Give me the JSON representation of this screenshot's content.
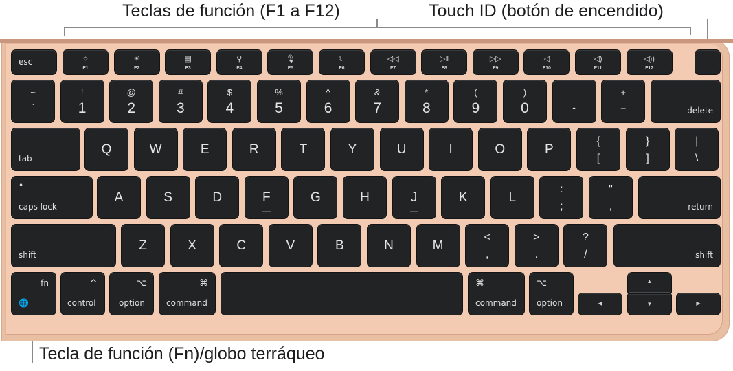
{
  "callouts": {
    "function_keys": "Teclas de función (F1 a F12)",
    "touch_id": "Touch ID (botón de encendido)",
    "fn_globe": "Tecla de función (Fn)/globo terráqueo"
  },
  "colors": {
    "keyboard_body": "#e9bfa4",
    "key": "#222325",
    "key_text": "#e4e4e4",
    "callout_line": "#8a8a8a"
  },
  "function_row": [
    {
      "label": "esc",
      "icon": "",
      "name": "escape-key"
    },
    {
      "label": "F1",
      "icon": "☼",
      "name": "brightness-down-icon"
    },
    {
      "label": "F2",
      "icon": "☀",
      "name": "brightness-up-icon"
    },
    {
      "label": "F3",
      "icon": "▤",
      "name": "mission-control-icon"
    },
    {
      "label": "F4",
      "icon": "⚲",
      "name": "spotlight-search-icon"
    },
    {
      "label": "F5",
      "icon": "🎙",
      "name": "dictation-icon"
    },
    {
      "label": "F6",
      "icon": "☾",
      "name": "do-not-disturb-icon"
    },
    {
      "label": "F7",
      "icon": "◁◁",
      "name": "rewind-icon"
    },
    {
      "label": "F8",
      "icon": "▷ǁ",
      "name": "play-pause-icon"
    },
    {
      "label": "F9",
      "icon": "▷▷",
      "name": "fast-forward-icon"
    },
    {
      "label": "F10",
      "icon": "◁",
      "name": "mute-icon"
    },
    {
      "label": "F11",
      "icon": "◁)",
      "name": "volume-down-icon"
    },
    {
      "label": "F12",
      "icon": "◁))",
      "name": "volume-up-icon"
    }
  ],
  "touch_id_label": "",
  "number_row": [
    {
      "top": "~",
      "bottom": "`"
    },
    {
      "top": "!",
      "bottom": "1"
    },
    {
      "top": "@",
      "bottom": "2"
    },
    {
      "top": "#",
      "bottom": "3"
    },
    {
      "top": "$",
      "bottom": "4"
    },
    {
      "top": "%",
      "bottom": "5"
    },
    {
      "top": "^",
      "bottom": "6"
    },
    {
      "top": "&",
      "bottom": "7"
    },
    {
      "top": "*",
      "bottom": "8"
    },
    {
      "top": "(",
      "bottom": "9"
    },
    {
      "top": ")",
      "bottom": "0"
    },
    {
      "top": "—",
      "bottom": "-"
    },
    {
      "top": "+",
      "bottom": "="
    }
  ],
  "delete_label": "delete",
  "tab_label": "tab",
  "qwerty_row": [
    "Q",
    "W",
    "E",
    "R",
    "T",
    "Y",
    "U",
    "I",
    "O",
    "P"
  ],
  "bracket_keys": [
    {
      "top": "{",
      "bottom": "["
    },
    {
      "top": "}",
      "bottom": "]"
    },
    {
      "top": "|",
      "bottom": "\\"
    }
  ],
  "caps_lock_label": "caps lock",
  "caps_lock_indicator": "•",
  "home_row": [
    "A",
    "S",
    "D",
    "F",
    "G",
    "H",
    "J",
    "K",
    "L"
  ],
  "home_punct": [
    {
      "top": ":",
      "bottom": ";"
    },
    {
      "top": "\"",
      "bottom": ","
    }
  ],
  "return_label": "return",
  "shift_label": "shift",
  "bottom_letters": [
    "Z",
    "X",
    "C",
    "V",
    "B",
    "N",
    "M"
  ],
  "bottom_punct": [
    {
      "top": "<",
      "bottom": ","
    },
    {
      "top": ">",
      "bottom": "."
    },
    {
      "top": "?",
      "bottom": "/"
    }
  ],
  "modifiers": {
    "fn": "fn",
    "globe": "🌐",
    "control": "control",
    "control_symbol": "^",
    "option": "option",
    "option_symbol": "⌥",
    "command": "command",
    "command_symbol": "⌘"
  },
  "arrows": {
    "left": "◀",
    "up": "▲",
    "down": "▼",
    "right": "▶"
  }
}
